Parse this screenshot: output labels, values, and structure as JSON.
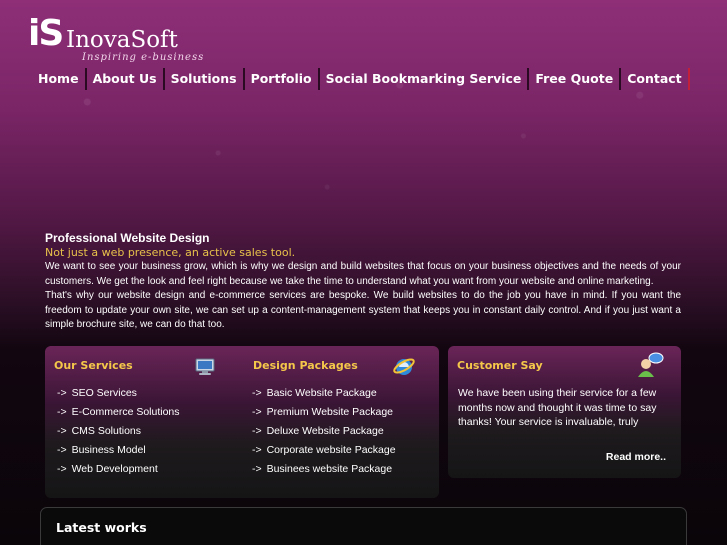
{
  "logo": {
    "mark": "iS",
    "name": "InovaSoft",
    "tagline": "Inspiring e-business"
  },
  "nav": [
    {
      "label": "Home"
    },
    {
      "label": "About Us"
    },
    {
      "label": "Solutions"
    },
    {
      "label": "Portfolio"
    },
    {
      "label": "Social Bookmarking Service"
    },
    {
      "label": "Free Quote"
    },
    {
      "label": "Contact"
    }
  ],
  "intro": {
    "title": "Professional Website Design",
    "subtitle": "Not just a web presence, an active sales tool.",
    "paragraph1": "We want to see your business grow, which is why we design and build websites that focus on your business objectives and the needs of your customers. We get the look and feel right because we take the time to understand what you want from your website and online marketing.",
    "paragraph2": "That's why our website design and e-commerce services are bespoke. We build websites to do the job you have in mind. If you want the freedom to update your own site, we can set up a content-management system that keeps you in constant daily control. And if you just want a simple brochure site, we can do that too."
  },
  "services": {
    "title": "Our Services",
    "items": [
      "SEO Services",
      "E-Commerce Solutions",
      "CMS Solutions",
      "Business Model",
      "Web Development"
    ]
  },
  "packages": {
    "title": "Design Packages",
    "items": [
      "Basic Website Package",
      "Premium Website Package",
      "Deluxe Website Package",
      "Corporate website Package",
      "Businees website Package"
    ]
  },
  "customer": {
    "title": "Customer Say",
    "quote": "We have been using their service for a few months now and thought it was time to say thanks! Your service is invaluable, truly",
    "read_more": "Read more.."
  },
  "latest": {
    "title": "Latest works"
  },
  "arrow": "->",
  "colors": {
    "accent": "#f5c84a",
    "subtitle": "#e7c24a",
    "brand": "#7a2566"
  },
  "icons": {
    "services": "monitor-icon",
    "packages": "internet-explorer-icon",
    "customer": "chat-user-icon"
  }
}
